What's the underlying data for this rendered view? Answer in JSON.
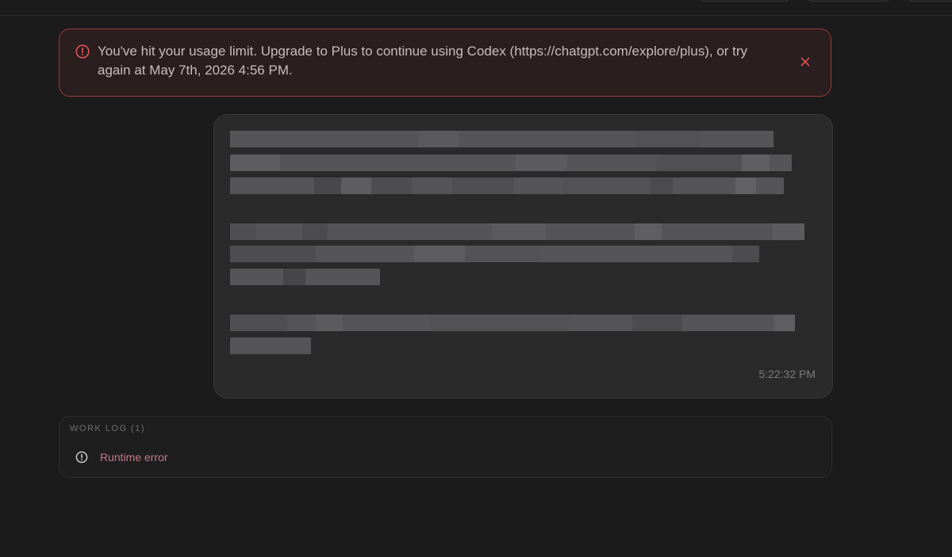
{
  "alert": {
    "message": "You've hit your usage limit. Upgrade to Plus to continue using Codex (https://chatgpt.com/explore/plus), or try again at May 7th, 2026 4:56 PM.",
    "icon": "alert-circle-icon",
    "close_icon": "close-icon",
    "accent_color": "#e0525a"
  },
  "message": {
    "content_redacted": true,
    "timestamp": "5:22:32 PM"
  },
  "worklog": {
    "title": "WORK LOG (1)",
    "items": [
      {
        "label": "Runtime error",
        "icon": "info-circle-icon"
      }
    ]
  }
}
